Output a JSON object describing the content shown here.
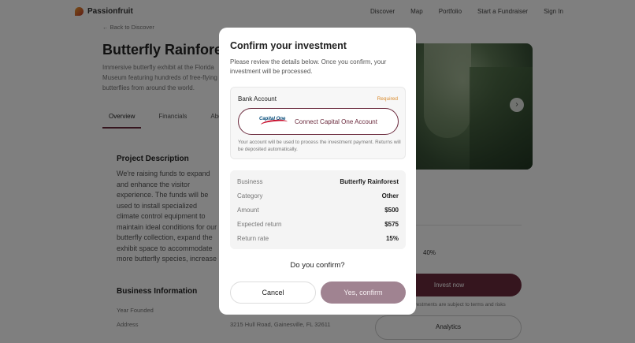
{
  "app": {
    "name": "Passionfruit"
  },
  "nav": {
    "links": [
      "Discover",
      "Map",
      "Portfolio",
      "Start a Fundraiser",
      "Sign In"
    ]
  },
  "background": {
    "back_link": "← Back to Discover",
    "title": "Butterfly Rainforest",
    "description": "Immersive butterfly exhibit at the Florida Museum featuring hundreds of free-flying butterflies from around the world.",
    "tabs": [
      "Overview",
      "Financials",
      "About Business"
    ],
    "project_heading": "Project Description",
    "project_body": "We're raising funds to expand and enhance the visitor experience. The funds will be used to install specialized climate control equipment to maintain ideal conditions for our butterfly collection, expand the exhibit space to accommodate more butterfly species, increase our inventory of butterflies, and launch educational marketing campaigns. This expansion will help us support conservation while providing an even more immersive experience.",
    "business_heading": "Business Information",
    "business_rows": [
      {
        "label": "Year Founded",
        "value": ""
      },
      {
        "label": "Address",
        "value": "3215 Hull Road, Gainesville, FL 32611"
      }
    ],
    "percent": "40%",
    "invest_label": "Invest now",
    "tiny_note": "Investments are subject to terms and risks",
    "analytics_label": "Analytics"
  },
  "modal": {
    "title": "Confirm your investment",
    "description": "Please review the details below. Once you confirm, your investment will be processed.",
    "bank": {
      "label": "Bank Account",
      "required": "Required",
      "logo_text": "Capital One",
      "connect_label": "Connect Capital One Account",
      "note": "Your account will be used to process the investment payment. Returns will be deposited automatically."
    },
    "details": [
      {
        "key": "Business",
        "value": "Butterfly Rainforest"
      },
      {
        "key": "Category",
        "value": "Other"
      },
      {
        "key": "Amount",
        "value": "$500"
      },
      {
        "key": "Expected return",
        "value": "$575"
      },
      {
        "key": "Return rate",
        "value": "15%"
      }
    ],
    "question": "Do you confirm?",
    "cancel_label": "Cancel",
    "confirm_label": "Yes, confirm"
  },
  "colors": {
    "accent": "#6b2a3d",
    "confirm_disabled": "#a08391",
    "required": "#d98a2b",
    "overlay": "rgba(0,0,0,0.5)"
  }
}
